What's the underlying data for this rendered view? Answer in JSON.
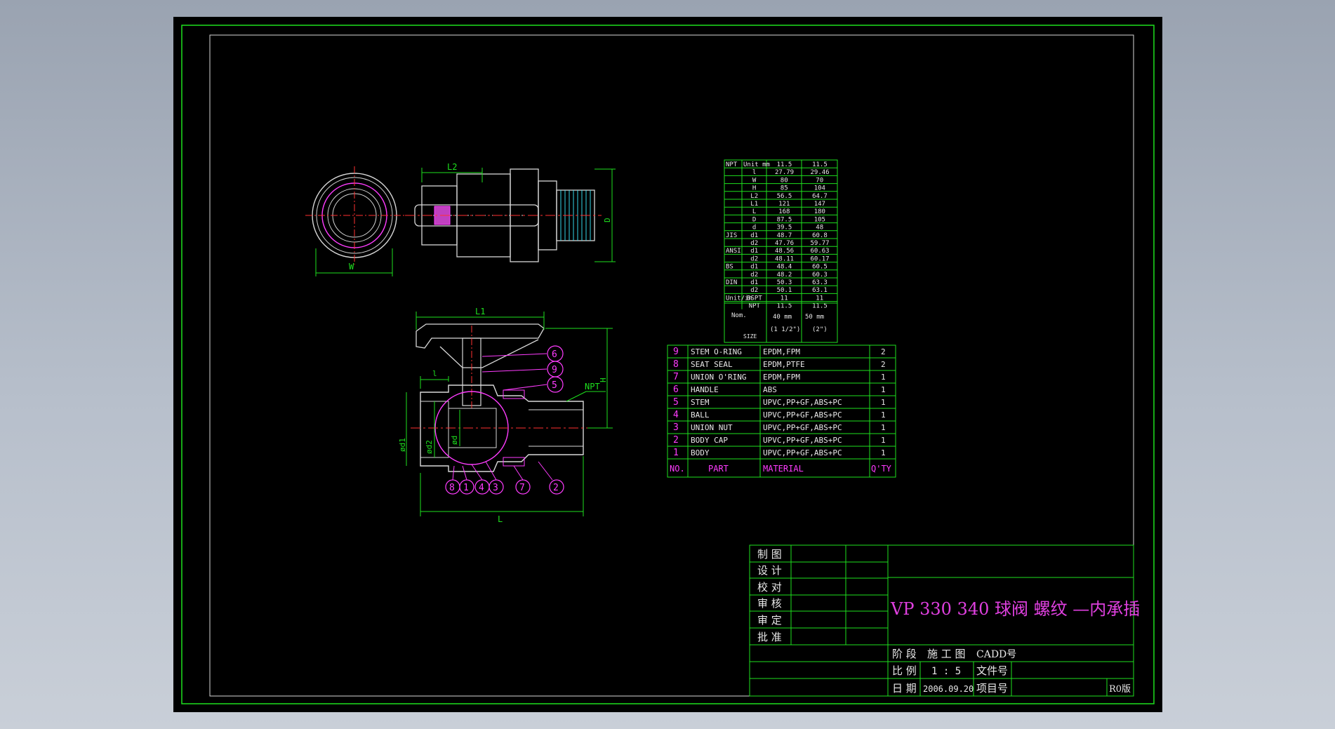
{
  "colors": {
    "background": "#000000",
    "frame": "#1ee01e",
    "outline": "#e8e8e8",
    "dimension": "#1ee01e",
    "center_line": "#ff3030",
    "part_body": "#ff3cff",
    "thread": "#33d6e8",
    "title": "#e040e0"
  },
  "views": {
    "top": {
      "dim_length": "L2",
      "dim_height": "D",
      "dim_width": "W"
    },
    "section": {
      "dim_length": "L1",
      "dim_total": "L",
      "dim_height": "H",
      "dim_socket": "l",
      "dim_d1": "ød1",
      "dim_d2": "ød2",
      "dim_d": "ød",
      "thread_label": "NPT",
      "balloons_right": [
        "6",
        "9",
        "5"
      ],
      "balloons_bottom": [
        "8",
        "1",
        "4",
        "3",
        "7",
        "2"
      ]
    }
  },
  "dim_table": {
    "header": [
      "NPT",
      "Unit mm",
      "11.5",
      "11.5"
    ],
    "rows": [
      [
        "",
        "l",
        "27.79",
        "29.46"
      ],
      [
        "",
        "W",
        "80",
        "70"
      ],
      [
        "",
        "H",
        "85",
        "104"
      ],
      [
        "",
        "L2",
        "56.5",
        "64.7"
      ],
      [
        "",
        "L1",
        "121",
        "147"
      ],
      [
        "",
        "L",
        "168",
        "180"
      ],
      [
        "",
        "D",
        "87.5",
        "105"
      ],
      [
        "",
        "d",
        "39.5",
        "48"
      ],
      [
        "JIS",
        "d1",
        "48.7",
        "60.8"
      ],
      [
        "",
        "d2",
        "47.76",
        "59.77"
      ],
      [
        "ANSI",
        "d1",
        "48.56",
        "60.63"
      ],
      [
        "",
        "d2",
        "48.11",
        "60.17"
      ],
      [
        "BS",
        "d1",
        "48.4",
        "60.5"
      ],
      [
        "",
        "d2",
        "48.2",
        "60.3"
      ],
      [
        "DIN",
        "d1",
        "50.3",
        "63.3"
      ],
      [
        "",
        "d2",
        "50.1",
        "63.1"
      ],
      [
        "Unit/in",
        "BSPT",
        "11",
        "11"
      ],
      [
        "",
        "NPT",
        "11.5",
        "11.5"
      ]
    ],
    "nom_label": "Nom.",
    "size_label": "SIZE",
    "size_1": "40 mm",
    "size_1_in": "(1 1/2\")",
    "size_2": "50 mm",
    "size_2_in": "(2\")"
  },
  "parts_list": {
    "rows": [
      [
        "9",
        "STEM O-RING",
        "EPDM,FPM",
        "2"
      ],
      [
        "8",
        "SEAT SEAL",
        "EPDM,PTFE",
        "2"
      ],
      [
        "7",
        "UNION O'RING",
        "EPDM,FPM",
        "1"
      ],
      [
        "6",
        "HANDLE",
        "ABS",
        "1"
      ],
      [
        "5",
        "STEM",
        "UPVC,PP+GF,ABS+PC",
        "1"
      ],
      [
        "4",
        "BALL",
        "UPVC,PP+GF,ABS+PC",
        "1"
      ],
      [
        "3",
        "UNION NUT",
        "UPVC,PP+GF,ABS+PC",
        "1"
      ],
      [
        "2",
        "BODY CAP",
        "UPVC,PP+GF,ABS+PC",
        "1"
      ],
      [
        "1",
        "BODY",
        "UPVC,PP+GF,ABS+PC",
        "1"
      ]
    ],
    "header": [
      "NO.",
      "PART",
      "MATERIAL",
      "Q'TY"
    ]
  },
  "title_block": {
    "left_labels": [
      "制  图",
      "设  计",
      "校  对",
      "审  核",
      "审  定",
      "批  准"
    ],
    "title": "VP  330  340  球阀  螺纹 —内承插",
    "stage_label": "阶 段",
    "stage_value": "施 工 图",
    "cadd_label": "CADD号",
    "scale_label": "比 例",
    "scale_value": "1 : 5",
    "file_label": "文件号",
    "date_label": "日 期",
    "date_value": "2006.09.20",
    "project_label": "项目号",
    "revision": "R0版"
  }
}
